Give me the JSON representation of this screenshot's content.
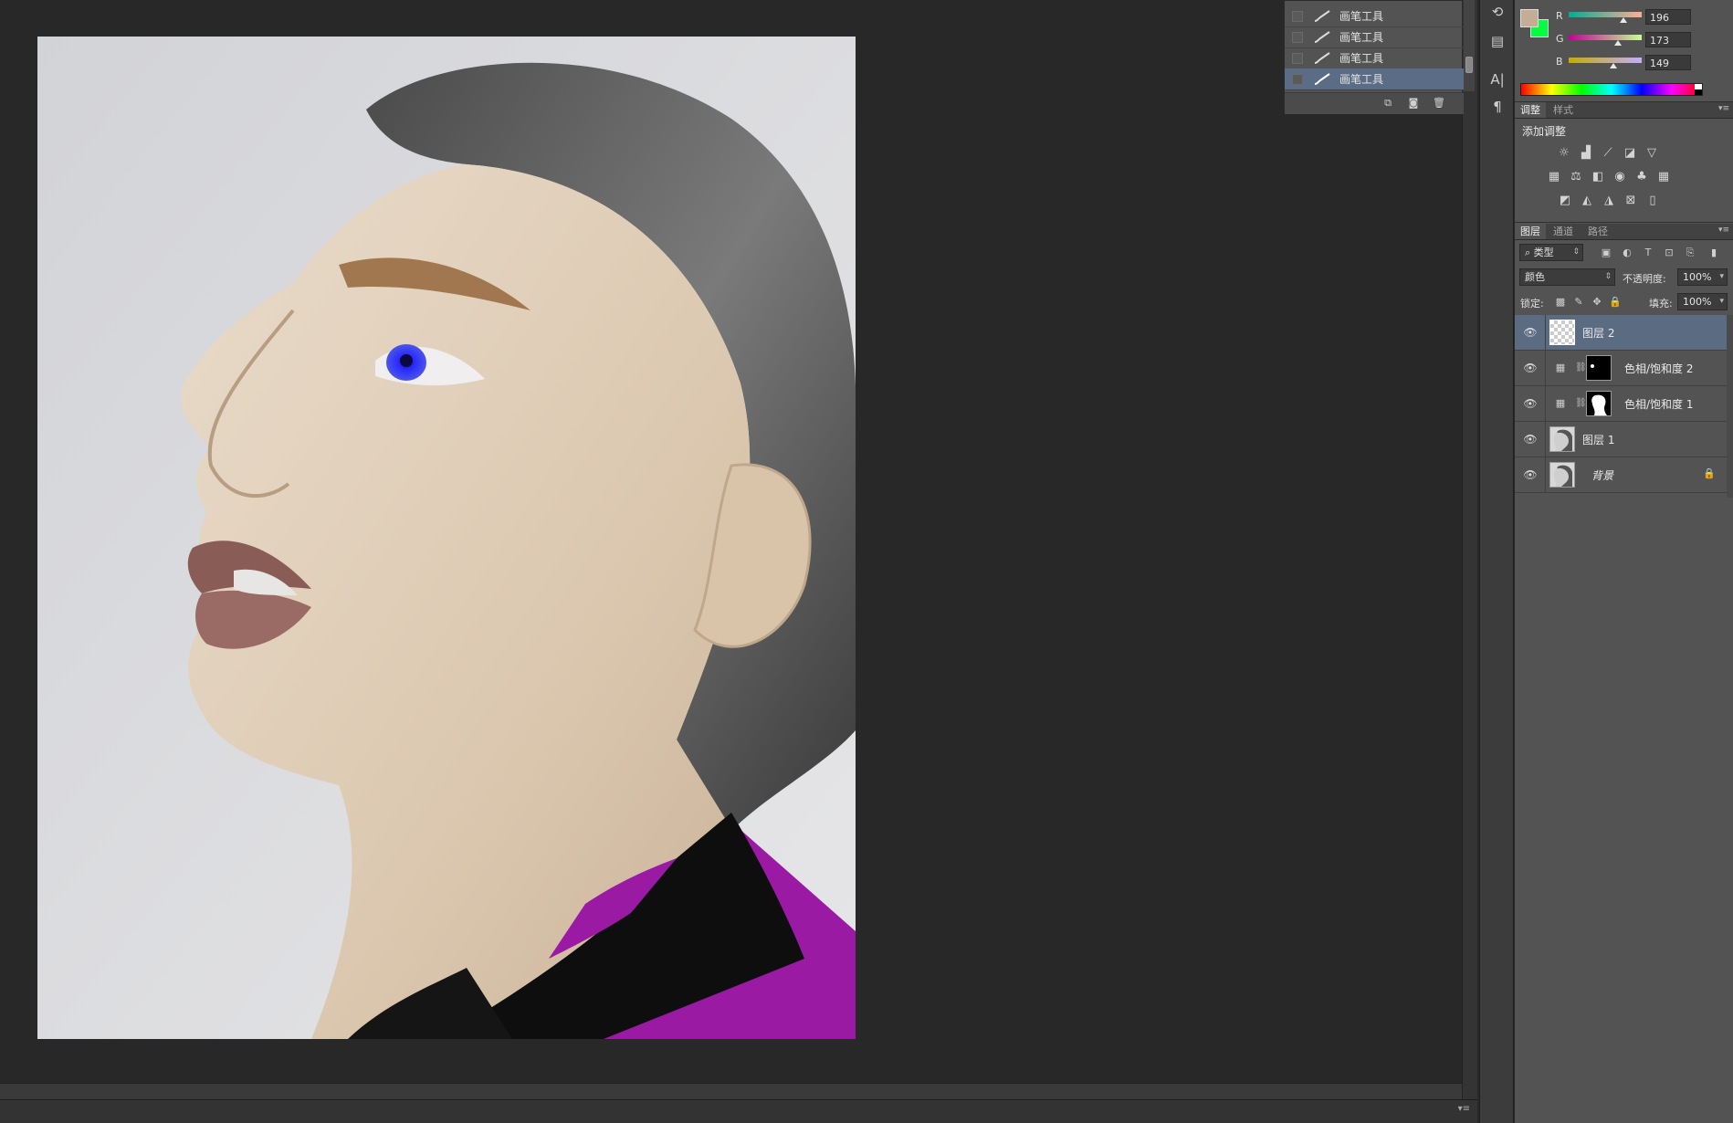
{
  "history": {
    "items": [
      {
        "label": "画笔工具",
        "active": false
      },
      {
        "label": "画笔工具",
        "active": false
      },
      {
        "label": "画笔工具",
        "active": false
      },
      {
        "label": "画笔工具",
        "active": true
      }
    ],
    "footer_icons": [
      "new-document-from-state-icon",
      "create-snapshot-icon",
      "delete-state-icon"
    ]
  },
  "color": {
    "foreground": "#c4ad95",
    "background": "#00ff40",
    "channels": [
      {
        "label": "R",
        "value": "196",
        "track": "linear-gradient(to right,#00ad95,#ffad95)"
      },
      {
        "label": "G",
        "value": "173",
        "track": "linear-gradient(to right,#c40095,#c4ff95)"
      },
      {
        "label": "B",
        "value": "149",
        "track": "linear-gradient(to right,#c4ad00,#c4adff)"
      }
    ]
  },
  "adjustments": {
    "tabs": [
      "调整",
      "样式"
    ],
    "title": "添加调整",
    "icons": [
      [
        "brightness-contrast-icon",
        "levels-icon",
        "curves-icon",
        "exposure-icon",
        "vibrance-icon"
      ],
      [
        "hue-saturation-icon",
        "color-balance-icon",
        "black-white-icon",
        "photo-filter-icon",
        "channel-mixer-icon",
        "color-lookup-icon"
      ],
      [
        "invert-icon",
        "posterize-icon",
        "threshold-icon",
        "selective-color-icon",
        "gradient-map-icon"
      ]
    ]
  },
  "layers": {
    "tabs": [
      "图层",
      "通道",
      "路径"
    ],
    "filter_kind": "类型",
    "blend_mode": "颜色",
    "opacity_label": "不透明度:",
    "opacity": "100%",
    "lock_label": "锁定:",
    "fill_label": "填充:",
    "fill": "100%",
    "items": [
      {
        "name": "图层 2",
        "kind": "pixel-empty",
        "selected": true,
        "italic": false,
        "locked": false
      },
      {
        "name": "色相/饱和度 2",
        "kind": "adjustment",
        "selected": false,
        "italic": false,
        "locked": false
      },
      {
        "name": "色相/饱和度 1",
        "kind": "adjustment",
        "selected": false,
        "italic": false,
        "locked": false
      },
      {
        "name": "图层 1",
        "kind": "pixel-photo",
        "selected": false,
        "italic": false,
        "locked": false
      },
      {
        "name": "背景",
        "kind": "pixel-photo",
        "selected": false,
        "italic": true,
        "locked": true
      }
    ]
  }
}
